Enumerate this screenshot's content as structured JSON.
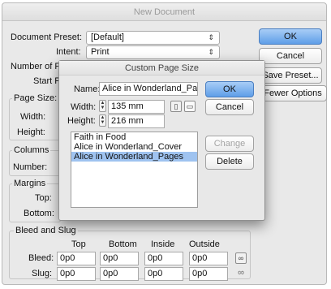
{
  "window": {
    "title": "New Document"
  },
  "document_preset": {
    "label": "Document Preset:",
    "value": "[Default]"
  },
  "intent": {
    "label": "Intent:",
    "value": "Print"
  },
  "number_of_pages": {
    "label": "Number of Pa"
  },
  "start_page": {
    "label": "Start Pa"
  },
  "page_size": {
    "label": "Page Size:",
    "width_label": "Width:",
    "height_label": "Height:"
  },
  "columns": {
    "title": "Columns",
    "number_label": "Number:"
  },
  "margins": {
    "title": "Margins",
    "top_label": "Top:",
    "bottom_label": "Bottom:"
  },
  "buttons": {
    "ok": "OK",
    "cancel": "Cancel",
    "save_preset": "Save Preset...",
    "fewer_options": "Fewer Options"
  },
  "bleed_slug": {
    "title": "Bleed and Slug",
    "headers": [
      "Top",
      "Bottom",
      "Inside",
      "Outside"
    ],
    "bleed_label": "Bleed:",
    "slug_label": "Slug:",
    "bleed_values": [
      "0p0",
      "0p0",
      "0p0",
      "0p0"
    ],
    "slug_values": [
      "0p0",
      "0p0",
      "0p0",
      "0p0"
    ]
  },
  "custom_page_size": {
    "title": "Custom Page Size",
    "name_label": "Name:",
    "name_value": "Alice in Wonderland_Pages",
    "width_label": "Width:",
    "width_value": "135 mm",
    "height_label": "Height:",
    "height_value": "216 mm",
    "ok": "OK",
    "cancel": "Cancel",
    "change": "Change",
    "delete": "Delete",
    "sizes": [
      "Faith in Food",
      "Alice in Wonderland_Cover",
      "Alice in Wonderland_Pages"
    ],
    "selected_size": "Alice in Wonderland_Pages"
  },
  "colors": {
    "accent_button": "#5f9ee8",
    "selection": "#9fc3f0"
  }
}
